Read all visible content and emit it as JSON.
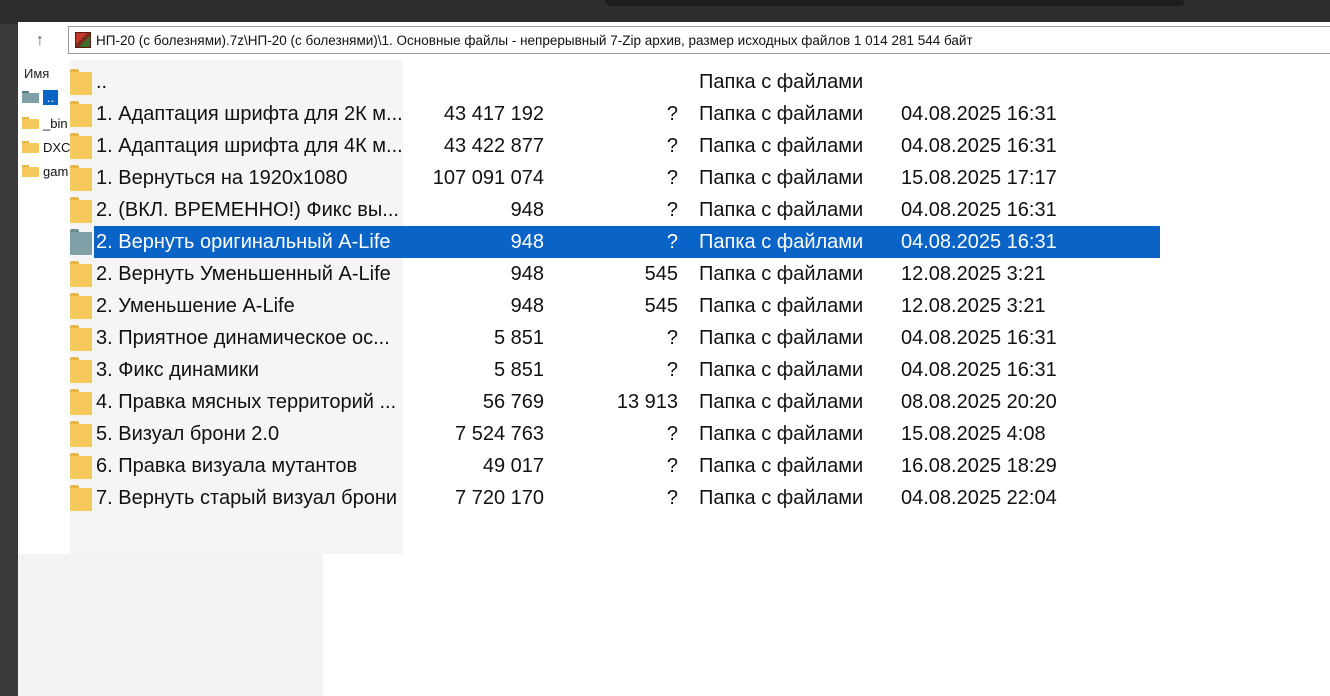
{
  "window": {
    "address_path": "НП-20 (с болезнями).7z\\НП-20 (с болезнями)\\1. Основные файлы - непрерывный 7-Zip архив, размер исходных файлов 1 014 281 544 байт",
    "up_arrow": "↑"
  },
  "left_pane": {
    "header": "Имя",
    "items": [
      {
        "label": ".."
      },
      {
        "label": "_bin"
      },
      {
        "label": "DXC"
      },
      {
        "label": "gam"
      }
    ]
  },
  "files": [
    {
      "name": "..",
      "size": "",
      "packed": "",
      "type": "Папка с файлами",
      "modified": "",
      "selected": false
    },
    {
      "name": "1. Адаптация шрифта для 2К м...",
      "size": "43 417 192",
      "packed": "?",
      "type": "Папка с файлами",
      "modified": "04.08.2025 16:31",
      "selected": false
    },
    {
      "name": "1. Адаптация шрифта для 4К м...",
      "size": "43 422 877",
      "packed": "?",
      "type": "Папка с файлами",
      "modified": "04.08.2025 16:31",
      "selected": false
    },
    {
      "name": "1. Вернуться на 1920x1080",
      "size": "107 091 074",
      "packed": "?",
      "type": "Папка с файлами",
      "modified": "15.08.2025 17:17",
      "selected": false
    },
    {
      "name": "2. (ВКЛ. ВРЕМЕННО!) Фикс вы...",
      "size": "948",
      "packed": "?",
      "type": "Папка с файлами",
      "modified": "04.08.2025 16:31",
      "selected": false
    },
    {
      "name": "2. Вернуть оригинальный A-Life",
      "size": "948",
      "packed": "?",
      "type": "Папка с файлами",
      "modified": "04.08.2025 16:31",
      "selected": true
    },
    {
      "name": "2. Вернуть Уменьшенный A-Life",
      "size": "948",
      "packed": "545",
      "type": "Папка с файлами",
      "modified": "12.08.2025 3:21",
      "selected": false
    },
    {
      "name": "2. Уменьшение A-Life",
      "size": "948",
      "packed": "545",
      "type": "Папка с файлами",
      "modified": "12.08.2025 3:21",
      "selected": false
    },
    {
      "name": "3. Приятное динамическое ос...",
      "size": "5 851",
      "packed": "?",
      "type": "Папка с файлами",
      "modified": "04.08.2025 16:31",
      "selected": false
    },
    {
      "name": "3. Фикс динамики",
      "size": "5 851",
      "packed": "?",
      "type": "Папка с файлами",
      "modified": "04.08.2025 16:31",
      "selected": false
    },
    {
      "name": "4. Правка мясных территорий ...",
      "size": "56 769",
      "packed": "13 913",
      "type": "Папка с файлами",
      "modified": "08.08.2025 20:20",
      "selected": false
    },
    {
      "name": "5. Визуал брони 2.0",
      "size": "7 524 763",
      "packed": "?",
      "type": "Папка с файлами",
      "modified": "15.08.2025 4:08",
      "selected": false
    },
    {
      "name": "6. Правка визуала мутантов",
      "size": "49 017",
      "packed": "?",
      "type": "Папка с файлами",
      "modified": "16.08.2025 18:29",
      "selected": false
    },
    {
      "name": "7. Вернуть старый визуал брони",
      "size": "7 720 170",
      "packed": "?",
      "type": "Папка с файлами",
      "modified": "04.08.2025 22:04",
      "selected": false
    }
  ],
  "colors": {
    "selection": "#0a64c8",
    "folder": "#f6c95c"
  }
}
